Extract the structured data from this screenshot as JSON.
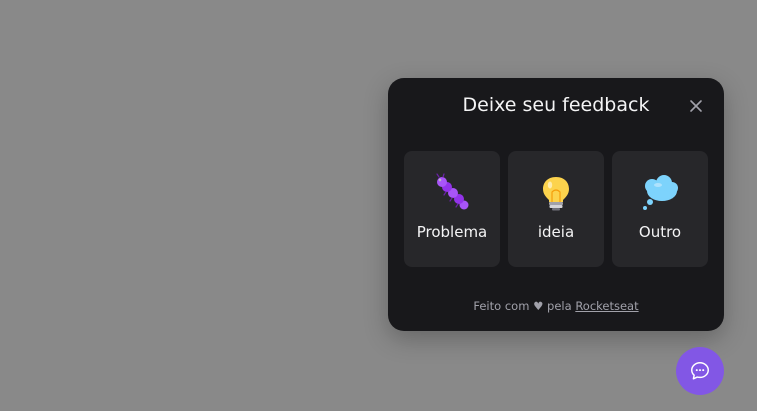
{
  "widget": {
    "title": "Deixe seu feedback",
    "close_icon": "close-icon",
    "feedback_types": [
      {
        "label": "Problema",
        "icon": "bug-icon",
        "color": "#a855f7"
      },
      {
        "label": "ideia",
        "icon": "lightbulb-icon",
        "color": "#fcd34d"
      },
      {
        "label": "Outro",
        "icon": "thought-bubble-icon",
        "color": "#7dd3fc"
      }
    ],
    "footer": {
      "prefix": "Feito com",
      "heart": "♥",
      "middle": "pela",
      "link_label": "Rocketseat"
    }
  },
  "fab": {
    "icon": "chat-bubble-icon",
    "color": "#8257e5"
  }
}
